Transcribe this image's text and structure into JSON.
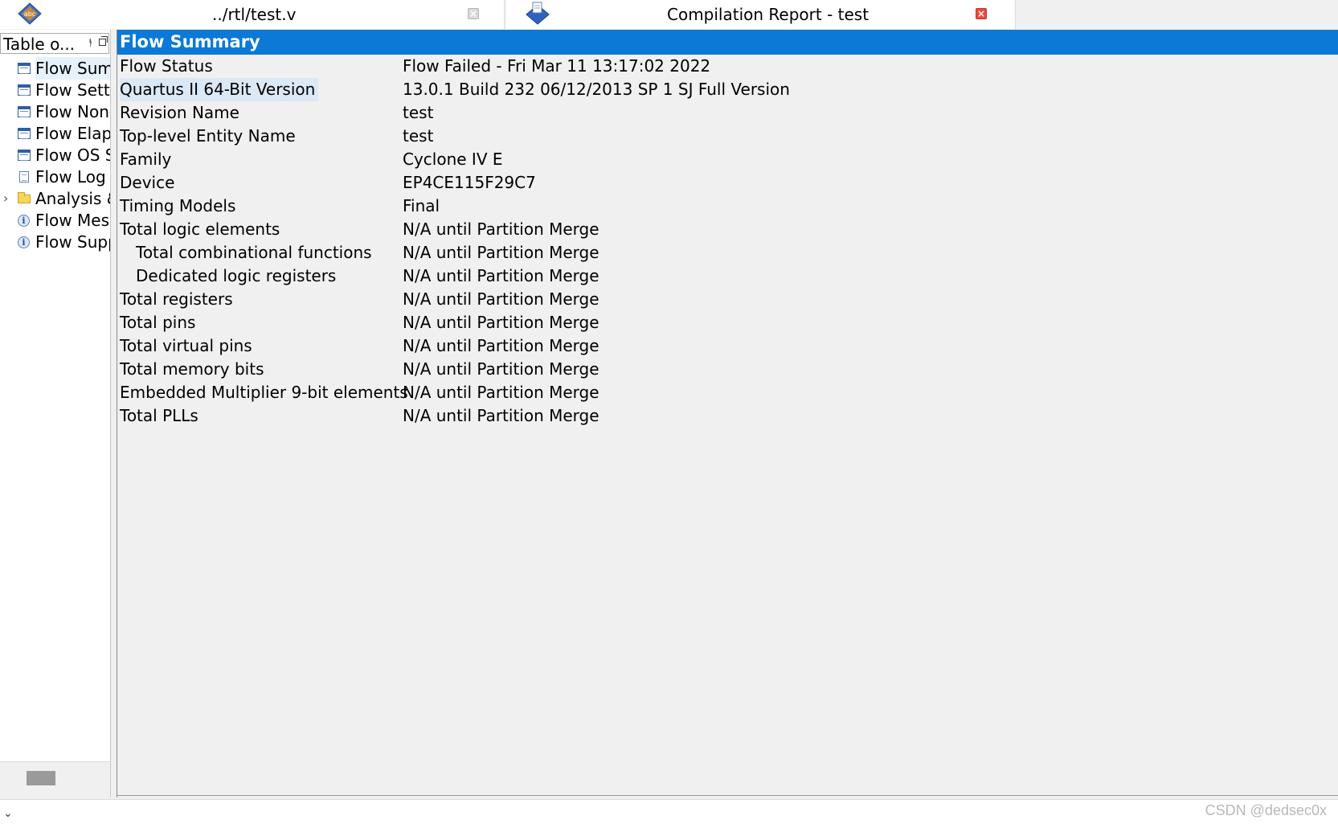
{
  "tabs": [
    {
      "title": "../rtl/test.v",
      "icon": "verilog-file-icon",
      "close_icon": "close-icon"
    },
    {
      "title": "Compilation Report - test",
      "icon": "report-icon",
      "close_icon": "close-icon"
    }
  ],
  "left_panel": {
    "title": "Table o...",
    "items": [
      {
        "label": "Flow Sum",
        "icon": "table-icon"
      },
      {
        "label": "Flow Setti",
        "icon": "table-icon"
      },
      {
        "label": "Flow Non-",
        "icon": "table-icon"
      },
      {
        "label": "Flow Elaps",
        "icon": "table-icon"
      },
      {
        "label": "Flow OS S",
        "icon": "table-icon"
      },
      {
        "label": "Flow Log",
        "icon": "document-icon"
      },
      {
        "label": "Analysis &",
        "icon": "folder-icon"
      },
      {
        "label": "Flow Mess",
        "icon": "info-icon"
      },
      {
        "label": "Flow Supp",
        "icon": "info-icon"
      }
    ]
  },
  "summary": {
    "title": "Flow Summary",
    "rows": [
      {
        "key": "Flow Status",
        "value": "Flow Failed - Fri Mar 11 13:17:02 2022"
      },
      {
        "key": "Quartus II 64-Bit Version",
        "value": "13.0.1 Build 232 06/12/2013 SP 1 SJ Full Version"
      },
      {
        "key": "Revision Name",
        "value": "test"
      },
      {
        "key": "Top-level Entity Name",
        "value": "test"
      },
      {
        "key": "Family",
        "value": "Cyclone IV E"
      },
      {
        "key": "Device",
        "value": "EP4CE115F29C7"
      },
      {
        "key": "Timing Models",
        "value": "Final"
      },
      {
        "key": "Total logic elements",
        "value": "N/A until Partition Merge"
      },
      {
        "key": "Total combinational functions",
        "value": "N/A until Partition Merge"
      },
      {
        "key": "Dedicated logic registers",
        "value": "N/A until Partition Merge"
      },
      {
        "key": "Total registers",
        "value": "N/A until Partition Merge"
      },
      {
        "key": "Total pins",
        "value": "N/A until Partition Merge"
      },
      {
        "key": "Total virtual pins",
        "value": "N/A until Partition Merge"
      },
      {
        "key": "Total memory bits",
        "value": "N/A until Partition Merge"
      },
      {
        "key": "Embedded Multiplier 9-bit elements",
        "value": "N/A until Partition Merge"
      },
      {
        "key": "Total PLLs",
        "value": "N/A until Partition Merge"
      }
    ]
  },
  "watermark": "CSDN @dedsec0x",
  "colors": {
    "header_blue": "#0b79d5",
    "selection": "#dbe8f6",
    "close_red": "#e84c3c"
  }
}
